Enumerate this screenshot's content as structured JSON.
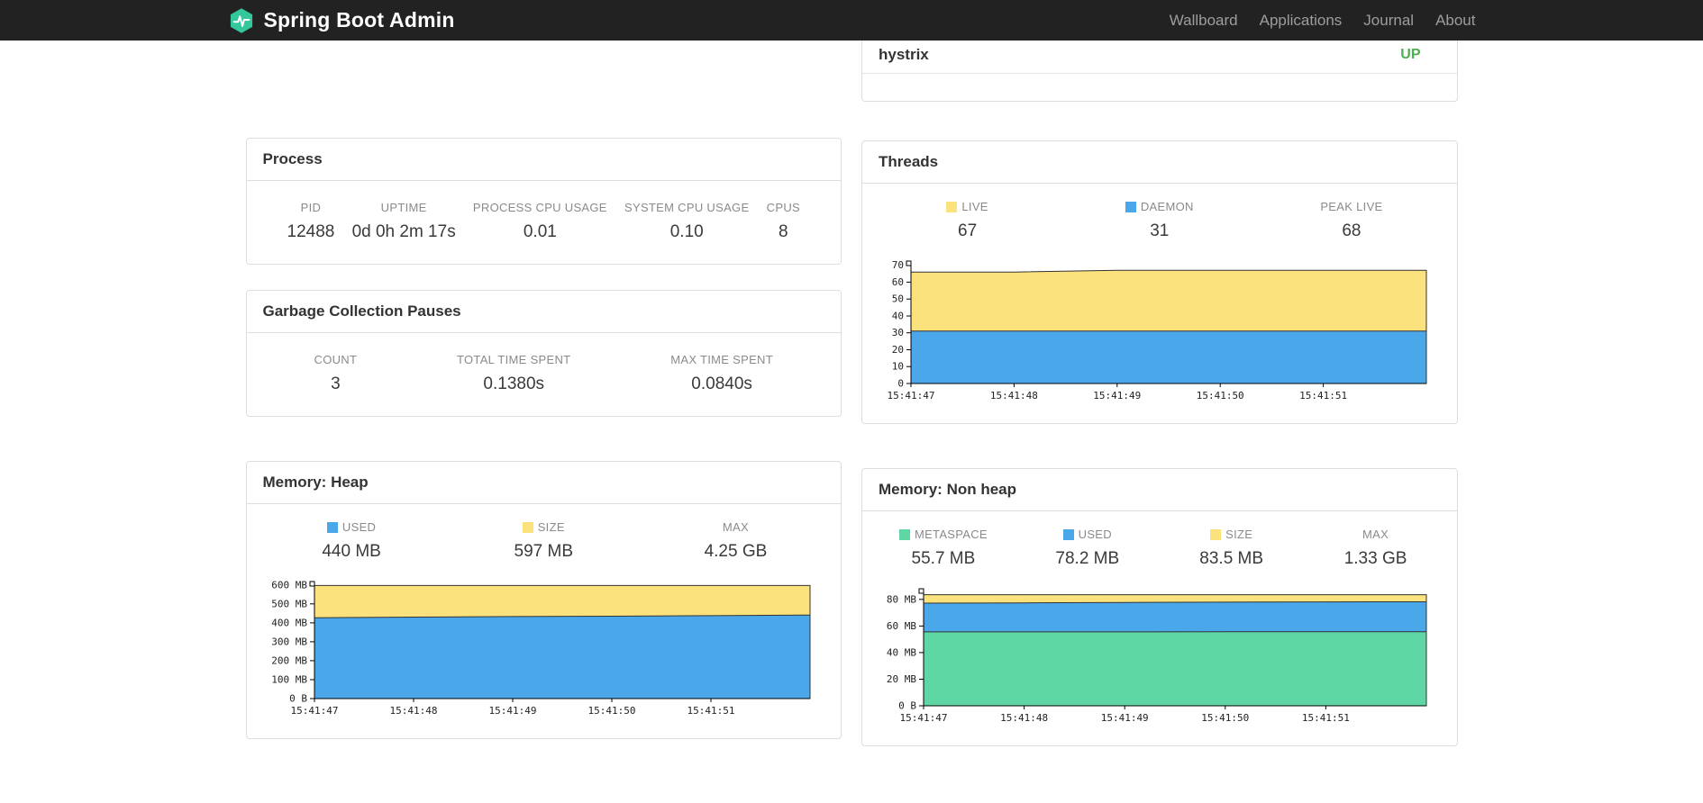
{
  "navbar": {
    "brand": "Spring Boot Admin",
    "links": [
      {
        "label": "Wallboard"
      },
      {
        "label": "Applications"
      },
      {
        "label": "Journal"
      },
      {
        "label": "About"
      }
    ]
  },
  "health": {
    "name": "hystrix",
    "status": "UP",
    "status_color": "#4caf50"
  },
  "process": {
    "title": "Process",
    "stats": [
      {
        "label": "PID",
        "value": "12488"
      },
      {
        "label": "UPTIME",
        "value": "0d 0h 2m 17s"
      },
      {
        "label": "PROCESS CPU USAGE",
        "value": "0.01"
      },
      {
        "label": "SYSTEM CPU USAGE",
        "value": "0.10"
      },
      {
        "label": "CPUS",
        "value": "8"
      }
    ]
  },
  "gc": {
    "title": "Garbage Collection Pauses",
    "stats": [
      {
        "label": "COUNT",
        "value": "3"
      },
      {
        "label": "TOTAL TIME SPENT",
        "value": "0.1380s"
      },
      {
        "label": "MAX TIME SPENT",
        "value": "0.0840s"
      }
    ]
  },
  "threads": {
    "title": "Threads",
    "legend": [
      {
        "label": "LIVE",
        "value": "67",
        "color": "#fce27d"
      },
      {
        "label": "DAEMON",
        "value": "31",
        "color": "#4aa8ea"
      },
      {
        "label": "PEAK LIVE",
        "value": "68",
        "color": null
      }
    ]
  },
  "memory_heap": {
    "title": "Memory: Heap",
    "legend": [
      {
        "label": "USED",
        "value": "440 MB",
        "color": "#4aa8ea"
      },
      {
        "label": "SIZE",
        "value": "597 MB",
        "color": "#fce27d"
      },
      {
        "label": "MAX",
        "value": "4.25 GB",
        "color": null
      }
    ]
  },
  "memory_nonheap": {
    "title": "Memory: Non heap",
    "legend": [
      {
        "label": "METASPACE",
        "value": "55.7 MB",
        "color": "#5fd7a4"
      },
      {
        "label": "USED",
        "value": "78.2 MB",
        "color": "#4aa8ea"
      },
      {
        "label": "SIZE",
        "value": "83.5 MB",
        "color": "#fce27d"
      },
      {
        "label": "MAX",
        "value": "1.33 GB",
        "color": null
      }
    ]
  },
  "chart_data": [
    {
      "id": "threads",
      "type": "area",
      "title": "Threads",
      "style": "overlaid-areas (drawn back to front, each from 0 to value)",
      "x_ticks": [
        "15:41:47",
        "15:41:48",
        "15:41:49",
        "15:41:50",
        "15:41:51"
      ],
      "y_max": 72.5,
      "y_ticks": [
        {
          "v": 0,
          "label": "0"
        },
        {
          "v": 10,
          "label": "10"
        },
        {
          "v": 20,
          "label": "20"
        },
        {
          "v": 30,
          "label": "30"
        },
        {
          "v": 40,
          "label": "40"
        },
        {
          "v": 50,
          "label": "50"
        },
        {
          "v": 60,
          "label": "60"
        },
        {
          "v": 70,
          "label": "70"
        }
      ],
      "series": [
        {
          "name": "LIVE",
          "color": "#fce27d",
          "values": [
            66,
            66,
            67,
            67,
            67,
            67
          ]
        },
        {
          "name": "DAEMON",
          "color": "#4aa8ea",
          "values": [
            31,
            31,
            31,
            31,
            31,
            31
          ]
        }
      ]
    },
    {
      "id": "heap",
      "type": "area",
      "title": "Memory: Heap",
      "style": "overlaid-areas (drawn back to front, each from 0 to value)",
      "y_unit": "MB",
      "x_ticks": [
        "15:41:47",
        "15:41:48",
        "15:41:49",
        "15:41:50",
        "15:41:51"
      ],
      "y_max": 618,
      "y_ticks": [
        {
          "v": 0,
          "label": "0 B"
        },
        {
          "v": 100,
          "label": "100 MB"
        },
        {
          "v": 200,
          "label": "200 MB"
        },
        {
          "v": 300,
          "label": "300 MB"
        },
        {
          "v": 400,
          "label": "400 MB"
        },
        {
          "v": 500,
          "label": "500 MB"
        },
        {
          "v": 600,
          "label": "600 MB"
        }
      ],
      "series": [
        {
          "name": "SIZE",
          "color": "#fce27d",
          "values": [
            597,
            597,
            597,
            597,
            597,
            597
          ]
        },
        {
          "name": "USED",
          "color": "#4aa8ea",
          "values": [
            427,
            430,
            433,
            435,
            438,
            441
          ]
        }
      ]
    },
    {
      "id": "nonheap",
      "type": "area",
      "title": "Memory: Non heap",
      "style": "overlaid-areas (drawn back to front, each from 0 to value)",
      "y_unit": "MB",
      "x_ticks": [
        "15:41:47",
        "15:41:48",
        "15:41:49",
        "15:41:50",
        "15:41:51"
      ],
      "y_max": 88,
      "y_ticks": [
        {
          "v": 0,
          "label": "0 B"
        },
        {
          "v": 20,
          "label": "20 MB"
        },
        {
          "v": 40,
          "label": "40 MB"
        },
        {
          "v": 60,
          "label": "60 MB"
        },
        {
          "v": 80,
          "label": "80 MB"
        }
      ],
      "series": [
        {
          "name": "SIZE",
          "color": "#fce27d",
          "values": [
            83.5,
            83.5,
            83.5,
            83.5,
            83.5,
            83.5
          ]
        },
        {
          "name": "USED",
          "color": "#4aa8ea",
          "values": [
            77.2,
            77.4,
            77.7,
            77.9,
            78.1,
            78.2
          ]
        },
        {
          "name": "METASPACE",
          "color": "#5fd7a4",
          "values": [
            55.6,
            55.6,
            55.6,
            55.7,
            55.7,
            55.7
          ]
        }
      ]
    }
  ]
}
